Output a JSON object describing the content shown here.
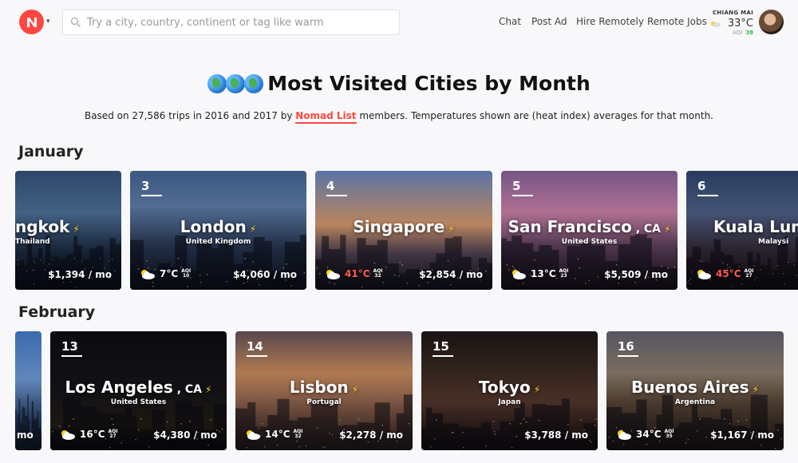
{
  "header": {
    "search_placeholder": "Try a city, country, continent or tag like warm",
    "nav": [
      "Chat",
      "Post Ad",
      "Hire Remotely",
      "Remote Jobs"
    ],
    "weather": {
      "city": "CHIANG MAI",
      "temp": "33°C",
      "aqi_label": "AQI",
      "aqi": "38"
    }
  },
  "title": "Most Visited Cities by Month",
  "subtitle": {
    "before": "Based on 27,586 trips in 2016 and 2017 by ",
    "link": "Nomad List",
    "after": " members. Temperatures shown are (heat index) averages for that month."
  },
  "months": [
    {
      "name": "January",
      "cards": [
        {
          "rank": "",
          "city": "ngkok",
          "state": "",
          "country": "Thailand",
          "temp": "",
          "aqi": "",
          "cost": "$1,394 / mo",
          "hot": false
        },
        {
          "rank": "3",
          "city": "London",
          "state": "",
          "country": "United Kingdom",
          "temp": "7°C",
          "aqi": "10",
          "cost": "$4,060 / mo",
          "hot": false
        },
        {
          "rank": "4",
          "city": "Singapore",
          "state": "",
          "country": "",
          "temp": "41°C",
          "aqi": "32",
          "cost": "$2,854 / mo",
          "hot": true
        },
        {
          "rank": "5",
          "city": "San Francisco",
          "state": ", CA",
          "country": "United States",
          "temp": "13°C",
          "aqi": "23",
          "cost": "$5,509 / mo",
          "hot": false
        },
        {
          "rank": "6",
          "city": "Kuala Lum",
          "state": "",
          "country": "Malaysi",
          "temp": "45°C",
          "aqi": "27",
          "cost": "",
          "hot": true
        }
      ]
    },
    {
      "name": "February",
      "cards": [
        {
          "rank": "",
          "city": "",
          "state": "",
          "country": "",
          "temp": "",
          "aqi": "",
          "cost": "mo",
          "hot": false
        },
        {
          "rank": "13",
          "city": "Los Angeles",
          "state": ", CA",
          "country": "United States",
          "temp": "16°C",
          "aqi": "27",
          "cost": "$4,380 / mo",
          "hot": false
        },
        {
          "rank": "14",
          "city": "Lisbon",
          "state": "",
          "country": "Portugal",
          "temp": "14°C",
          "aqi": "32",
          "cost": "$2,278 / mo",
          "hot": false
        },
        {
          "rank": "15",
          "city": "Tokyo",
          "state": "",
          "country": "Japan",
          "temp": "",
          "aqi": "",
          "cost": "$3,788 / mo",
          "hot": false
        },
        {
          "rank": "16",
          "city": "Buenos Aires",
          "state": "",
          "country": "Argentina",
          "temp": "34°C",
          "aqi": "35",
          "cost": "$1,167 / mo",
          "hot": false
        }
      ]
    }
  ],
  "aqi_label": "AQI",
  "colors": {
    "brand": "#ff4742",
    "bolt": "#ffd21f",
    "hot_temp": "#ff5a4f",
    "aqi_good": "#3bb54a"
  }
}
